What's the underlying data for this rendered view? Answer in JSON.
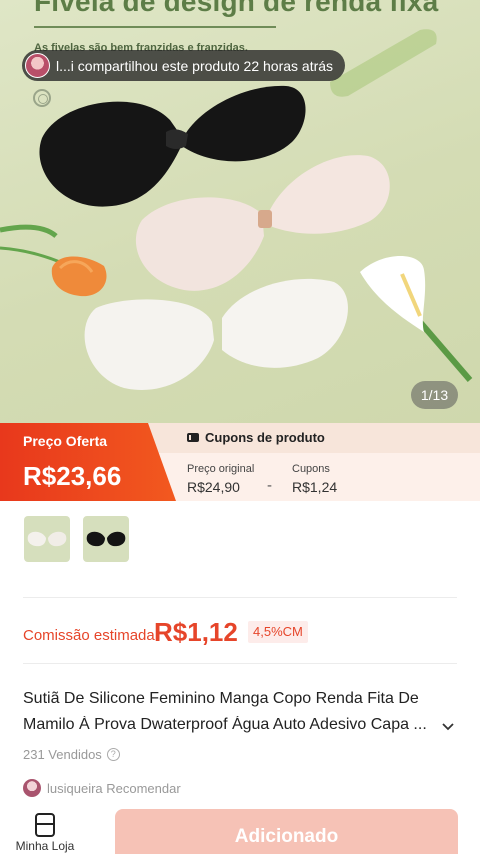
{
  "hero": {
    "banner_title": "Fivela de design de renda fixa",
    "banner_subtitle": "As fivelas são bem franzidas e franzidas.",
    "share_text": "l...i compartilhou este produto 22 horas atrás",
    "image_counter": "1/13"
  },
  "price": {
    "offer_label": "Preço Oferta",
    "offer_price": "R$23,66",
    "coupons_header": "Cupons de produto",
    "original_label": "Preço original",
    "original_value": "R$24,90",
    "minus_sign": "-",
    "coupons_label": "Cupons",
    "coupons_value": "R$1,24"
  },
  "thumbnails": [
    "white-bra-thumbnail",
    "black-bra-thumbnail"
  ],
  "commission": {
    "label": "Comissão estimada",
    "value": "R$1,12",
    "rate": "4,5%CM"
  },
  "product": {
    "title_line1": "Sutiã De Silicone Feminino Manga Copo Renda Fita De",
    "title_line2": "Mamilo À Prova Dwaterproof Água Auto Adesivo Capa ...",
    "sold": "231 Vendidos",
    "recommender": "lusiqueira Recomendar"
  },
  "bottom_bar": {
    "store_label": "Minha Loja",
    "add_button": "Adicionado"
  },
  "colors": {
    "accent_orange": "#e8381c",
    "commission_red": "#e6452a",
    "button_disabled": "#f6c2b6",
    "hero_background": "#d4dcb4"
  }
}
